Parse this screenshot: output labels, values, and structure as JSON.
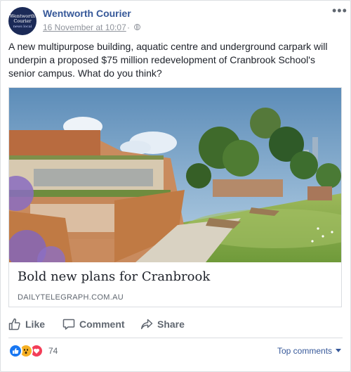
{
  "post": {
    "page_name": "Wentworth Courier",
    "avatar": {
      "line1": "Wentworth",
      "line2": "Courier",
      "line3": "news local"
    },
    "timestamp": "16 November at 10:07",
    "separator_dot": "·",
    "privacy_icon": "globe-icon",
    "more_label": "•••",
    "text": "A new multipurpose building, aquatic centre and underground carpark will underpin a proposed $75 million redevelopment of Cranbrook School's senior campus. What do you think?"
  },
  "link_preview": {
    "title": "Bold new plans for Cranbrook",
    "domain": "DAILYTELEGRAPH.COM.AU"
  },
  "actions": {
    "like": "Like",
    "comment": "Comment",
    "share": "Share"
  },
  "reactions": {
    "icons": [
      "like-reaction-icon",
      "wow-reaction-icon",
      "love-reaction-icon"
    ],
    "count": "74",
    "top_comments": "Top comments"
  },
  "colors": {
    "link": "#365899",
    "like": "#1877f2",
    "wow": "#f7b125",
    "love": "#f33e58",
    "avatar_bg": "#1b2a57"
  }
}
